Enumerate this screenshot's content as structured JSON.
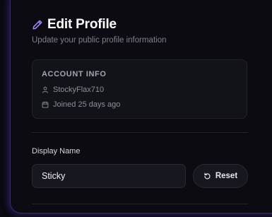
{
  "header": {
    "title": "Edit Profile",
    "subtitle": "Update your public profile information",
    "icon": "pencil-icon"
  },
  "account_info": {
    "heading": "ACCOUNT INFO",
    "username": "StockyFlax710",
    "username_icon": "user-icon",
    "joined": "Joined 25 days ago",
    "joined_icon": "calendar-icon"
  },
  "display_name": {
    "label": "Display Name",
    "value": "Sticky"
  },
  "reset": {
    "label": "Reset",
    "icon": "reset-icon"
  },
  "colors": {
    "accent": "#a78bfa",
    "card_border": "#3a2a66",
    "background": "#0b0b11"
  }
}
